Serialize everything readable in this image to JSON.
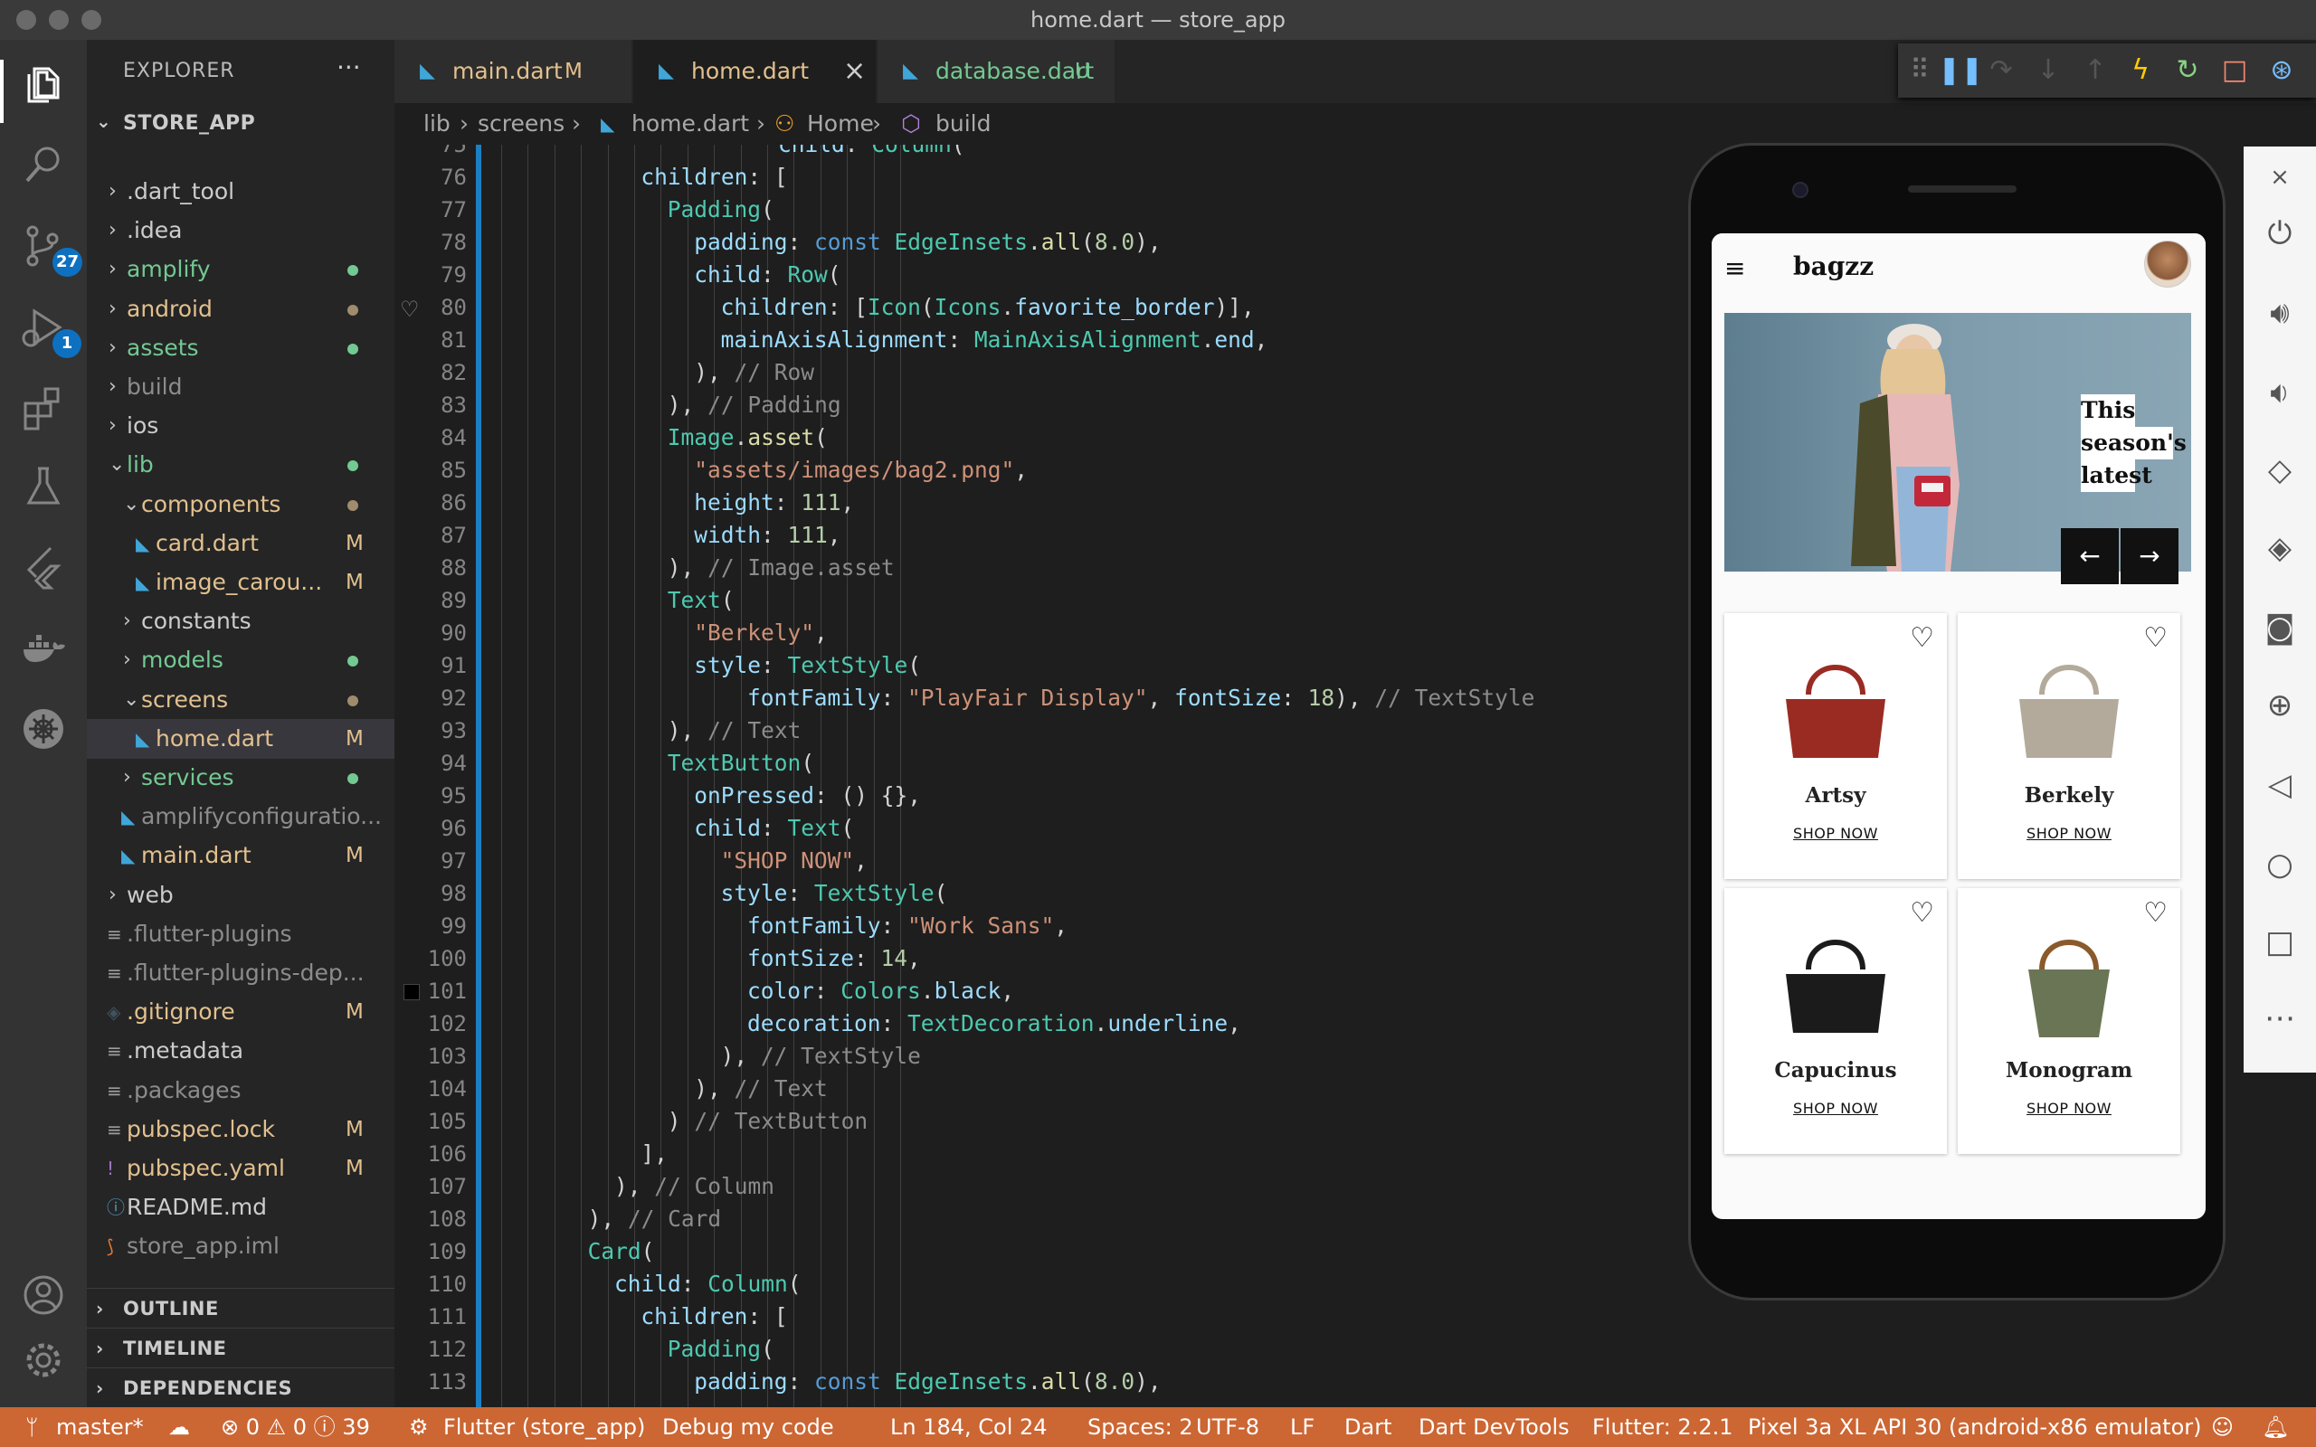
{
  "window": {
    "title": "home.dart — store_app"
  },
  "activity": {
    "scm_badge": "27",
    "debug_badge": "1"
  },
  "explorer": {
    "title": "EXPLORER",
    "more": "···",
    "project": "STORE_APP",
    "items": [
      {
        "name": ".dart_tool",
        "color": "#cccccc",
        "type": "folder-closed",
        "depth": 1
      },
      {
        "name": ".idea",
        "color": "#cccccc",
        "type": "folder-closed",
        "depth": 1
      },
      {
        "name": "amplify",
        "color": "#73c991",
        "type": "folder-closed",
        "depth": 1,
        "dot": "#73c991"
      },
      {
        "name": "android",
        "color": "#e2c08d",
        "type": "folder-closed",
        "depth": 1,
        "dot": "#a08c6c"
      },
      {
        "name": "assets",
        "color": "#73c991",
        "type": "folder-closed",
        "depth": 1,
        "dot": "#73c991"
      },
      {
        "name": "build",
        "color": "#8c8c8c",
        "type": "folder-closed",
        "depth": 1
      },
      {
        "name": "ios",
        "color": "#cccccc",
        "type": "folder-closed",
        "depth": 1
      },
      {
        "name": "lib",
        "color": "#73c991",
        "type": "folder-open",
        "depth": 1,
        "dot": "#73c991"
      },
      {
        "name": "components",
        "color": "#e2c08d",
        "type": "folder-open",
        "depth": 2,
        "dot": "#a08c6c"
      },
      {
        "name": "card.dart",
        "color": "#e2c08d",
        "type": "dart",
        "depth": 3,
        "status": "M"
      },
      {
        "name": "image_carou...",
        "color": "#e2c08d",
        "type": "dart",
        "depth": 3,
        "status": "M"
      },
      {
        "name": "constants",
        "color": "#cccccc",
        "type": "folder-closed",
        "depth": 2
      },
      {
        "name": "models",
        "color": "#73c991",
        "type": "folder-closed",
        "depth": 2,
        "dot": "#73c991"
      },
      {
        "name": "screens",
        "color": "#e2c08d",
        "type": "folder-open",
        "depth": 2,
        "dot": "#a08c6c"
      },
      {
        "name": "home.dart",
        "color": "#e2c08d",
        "type": "dart",
        "depth": 3,
        "status": "M",
        "selected": true
      },
      {
        "name": "services",
        "color": "#73c991",
        "type": "folder-closed",
        "depth": 2,
        "dot": "#73c991"
      },
      {
        "name": "amplifyconfiguratio...",
        "color": "#8c8c8c",
        "type": "dart",
        "depth": 2
      },
      {
        "name": "main.dart",
        "color": "#e2c08d",
        "type": "dart",
        "depth": 2,
        "status": "M"
      },
      {
        "name": "web",
        "color": "#cccccc",
        "type": "folder-closed",
        "depth": 1
      },
      {
        "name": ".flutter-plugins",
        "color": "#8c8c8c",
        "type": "lines",
        "depth": 1
      },
      {
        "name": ".flutter-plugins-dep...",
        "color": "#8c8c8c",
        "type": "lines",
        "depth": 1
      },
      {
        "name": ".gitignore",
        "color": "#e2c08d",
        "type": "git",
        "depth": 1,
        "status": "M"
      },
      {
        "name": ".metadata",
        "color": "#cccccc",
        "type": "lines",
        "depth": 1
      },
      {
        "name": ".packages",
        "color": "#8c8c8c",
        "type": "lines",
        "depth": 1
      },
      {
        "name": "pubspec.lock",
        "color": "#e2c08d",
        "type": "lines",
        "depth": 1,
        "status": "M"
      },
      {
        "name": "pubspec.yaml",
        "color": "#e2c08d",
        "type": "excl",
        "depth": 1,
        "status": "M"
      },
      {
        "name": "README.md",
        "color": "#cccccc",
        "type": "info",
        "depth": 1
      },
      {
        "name": "store_app.iml",
        "color": "#8c8c8c",
        "type": "rss",
        "depth": 1
      }
    ],
    "sections": [
      "OUTLINE",
      "TIMELINE",
      "DEPENDENCIES"
    ]
  },
  "tabs": [
    {
      "name": "main.dart",
      "mod": "M"
    },
    {
      "name": "home.dart",
      "mod": "M",
      "close": "×"
    },
    {
      "name": "database.dart",
      "mod": "U"
    }
  ],
  "breadcrumbs": {
    "a": "lib",
    "b": "screens",
    "c": "home.dart",
    "d": "Home",
    "e": "build"
  },
  "editor": {
    "partial_top": "75",
    "partial_top_code": "child: Column(",
    "lines": [
      {
        "n": "76",
        "ind": 12,
        "code": "<span class=\"p\">children</span>: ["
      },
      {
        "n": "77",
        "ind": 14,
        "code": "<span class=\"c\">Padding</span>("
      },
      {
        "n": "78",
        "ind": 16,
        "code": "<span class=\"p\">padding</span>: <span class=\"k\">const</span> <span class=\"c\">EdgeInsets</span>.<span class=\"f\">all</span>(<span class=\"n\">8.0</span>),"
      },
      {
        "n": "79",
        "ind": 16,
        "code": "<span class=\"p\">child</span>: <span class=\"c\">Row</span>("
      },
      {
        "n": "80",
        "ind": 18,
        "code": "<span class=\"p\">children</span>: [<span class=\"c\">Icon</span>(<span class=\"c\">Icons</span>.<span class=\"p\">favorite_border</span>)],"
      },
      {
        "n": "81",
        "ind": 18,
        "code": "<span class=\"p\">mainAxisAlignment</span>: <span class=\"c\">MainAxisAlignment</span>.<span class=\"p\">end</span>,"
      },
      {
        "n": "82",
        "ind": 16,
        "code": "), <span class=\"cm\">// Row</span>"
      },
      {
        "n": "83",
        "ind": 14,
        "code": "), <span class=\"cm\">// Padding</span>"
      },
      {
        "n": "84",
        "ind": 14,
        "code": "<span class=\"c\">Image</span>.<span class=\"f\">asset</span>("
      },
      {
        "n": "85",
        "ind": 16,
        "code": "<span class=\"s\">\"assets/images/bag2.png\"</span>,"
      },
      {
        "n": "86",
        "ind": 16,
        "code": "<span class=\"p\">height</span>: <span class=\"n\">111</span>,"
      },
      {
        "n": "87",
        "ind": 16,
        "code": "<span class=\"p\">width</span>: <span class=\"n\">111</span>,"
      },
      {
        "n": "88",
        "ind": 14,
        "code": "), <span class=\"cm\">// Image.asset</span>"
      },
      {
        "n": "89",
        "ind": 14,
        "code": "<span class=\"c\">Text</span>("
      },
      {
        "n": "90",
        "ind": 16,
        "code": "<span class=\"s\">\"Berkely\"</span>,"
      },
      {
        "n": "91",
        "ind": 16,
        "code": "<span class=\"p\">style</span>: <span class=\"c\">TextStyle</span>("
      },
      {
        "n": "92",
        "ind": 20,
        "code": "<span class=\"p\">fontFamily</span>: <span class=\"s\">\"PlayFair Display\"</span>, <span class=\"p\">fontSize</span>: <span class=\"n\">18</span>), <span class=\"cm\">// TextStyle</span>"
      },
      {
        "n": "93",
        "ind": 14,
        "code": "), <span class=\"cm\">// Text</span>"
      },
      {
        "n": "94",
        "ind": 14,
        "code": "<span class=\"c\">TextButton</span>("
      },
      {
        "n": "95",
        "ind": 16,
        "code": "<span class=\"p\">onPressed</span>: () {},"
      },
      {
        "n": "96",
        "ind": 16,
        "code": "<span class=\"p\">child</span>: <span class=\"c\">Text</span>("
      },
      {
        "n": "97",
        "ind": 18,
        "code": "<span class=\"s\">\"SHOP NOW\"</span>,"
      },
      {
        "n": "98",
        "ind": 18,
        "code": "<span class=\"p\">style</span>: <span class=\"c\">TextStyle</span>("
      },
      {
        "n": "99",
        "ind": 20,
        "code": "<span class=\"p\">fontFamily</span>: <span class=\"s\">\"Work Sans\"</span>,"
      },
      {
        "n": "100",
        "ind": 20,
        "code": "<span class=\"p\">fontSize</span>: <span class=\"n\">14</span>,"
      },
      {
        "n": "101",
        "ind": 20,
        "code": "<span class=\"p\">color</span>: <span class=\"c\">Colors</span>.<span class=\"p\">black</span>,"
      },
      {
        "n": "102",
        "ind": 20,
        "code": "<span class=\"p\">decoration</span>: <span class=\"c\">TextDecoration</span>.<span class=\"p\">underline</span>,"
      },
      {
        "n": "103",
        "ind": 18,
        "code": "), <span class=\"cm\">// TextStyle</span>"
      },
      {
        "n": "104",
        "ind": 16,
        "code": "), <span class=\"cm\">// Text</span>"
      },
      {
        "n": "105",
        "ind": 14,
        "code": ") <span class=\"cm\">// TextButton</span>"
      },
      {
        "n": "106",
        "ind": 12,
        "code": "],"
      },
      {
        "n": "107",
        "ind": 10,
        "code": "), <span class=\"cm\">// Column</span>"
      },
      {
        "n": "108",
        "ind": 8,
        "code": "), <span class=\"cm\">// Card</span>"
      },
      {
        "n": "109",
        "ind": 8,
        "code": "<span class=\"c\">Card</span>("
      },
      {
        "n": "110",
        "ind": 10,
        "code": "<span class=\"p\">child</span>: <span class=\"c\">Column</span>("
      },
      {
        "n": "111",
        "ind": 12,
        "code": "<span class=\"p\">children</span>: ["
      },
      {
        "n": "112",
        "ind": 14,
        "code": "<span class=\"c\">Padding</span>("
      },
      {
        "n": "113",
        "ind": 16,
        "code": "<span class=\"p\">padding</span>: <span class=\"k\">const</span> <span class=\"c\">EdgeInsets</span>.<span class=\"f\">all</span>(<span class=\"n\">8.0</span>),"
      }
    ]
  },
  "statusbar": {
    "branch": "master*",
    "problems": "⊗ 0 ⚠ 0 ⓘ 39",
    "launch": "Flutter (store_app)",
    "debug_mode": "Debug my code",
    "position": "Ln 184, Col 24",
    "spaces": "Spaces: 2",
    "encoding": "UTF-8",
    "eol": "LF",
    "language": "Dart",
    "devtools": "Dart DevTools",
    "flutter": "Flutter: 2.2.1",
    "device": "Pixel 3a XL API 30 (android-x86 emulator)"
  },
  "app": {
    "brand": "bagzz",
    "hero_text_1": "This",
    "hero_text_2": "season's",
    "hero_text_3": "latest",
    "products": [
      {
        "name": "Artsy",
        "cta": "SHOP NOW",
        "bag_color": "#9a2b22"
      },
      {
        "name": "Berkely",
        "cta": "SHOP NOW",
        "bag_color": "#b3aa9c"
      },
      {
        "name": "Capucinus",
        "cta": "SHOP NOW",
        "bag_color": "#1b1b1b"
      },
      {
        "name": "Monogram",
        "cta": "SHOP NOW",
        "bag_color": "#6a7556"
      }
    ]
  },
  "colors": {
    "accent": "#0e70c0",
    "statusbar": "#cc6633",
    "modified": "#e2c08d",
    "untracked": "#73c991"
  }
}
